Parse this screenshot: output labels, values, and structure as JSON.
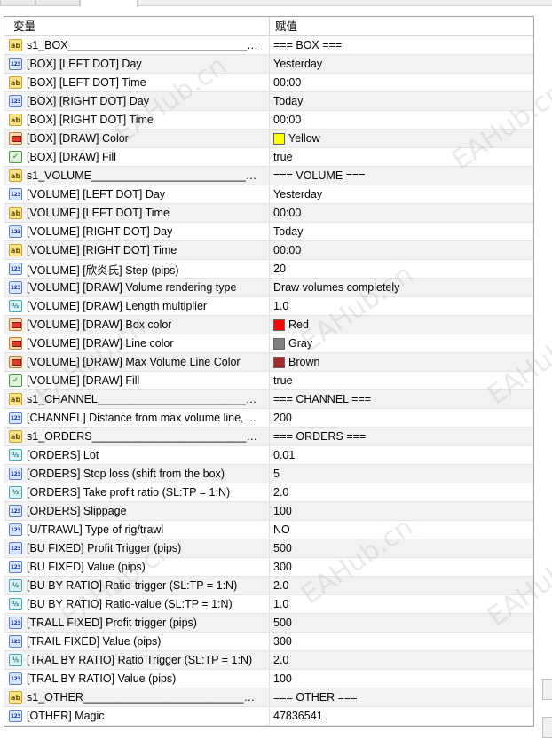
{
  "header": {
    "col_name": "变量",
    "col_value": "赋值"
  },
  "rows": [
    {
      "icon": "ab",
      "name": "s1_BOX________________________________________________",
      "value": "=== BOX ===",
      "sep": true
    },
    {
      "icon": "n123",
      "name": "[BOX] [LEFT DOT] Day",
      "value": "Yesterday"
    },
    {
      "icon": "ab",
      "name": "[BOX] [LEFT DOT] Time",
      "value": "00:00"
    },
    {
      "icon": "n123",
      "name": "[BOX] [RIGHT DOT] Day",
      "value": "Today"
    },
    {
      "icon": "ab",
      "name": "[BOX] [RIGHT DOT] Time",
      "value": "00:00"
    },
    {
      "icon": "color",
      "name": "[BOX] [DRAW] Color",
      "value": "Yellow",
      "swatch": "#ffff00"
    },
    {
      "icon": "bool",
      "name": "[BOX] [DRAW] Fill",
      "value": "true"
    },
    {
      "icon": "ab",
      "name": "s1_VOLUME______________________________________________",
      "value": "=== VOLUME ===",
      "sep": true
    },
    {
      "icon": "n123",
      "name": "[VOLUME] [LEFT DOT] Day",
      "value": "Yesterday"
    },
    {
      "icon": "ab",
      "name": "[VOLUME] [LEFT DOT] Time",
      "value": "00:00"
    },
    {
      "icon": "n123",
      "name": "[VOLUME] [RIGHT DOT] Day",
      "value": "Today"
    },
    {
      "icon": "ab",
      "name": "[VOLUME] [RIGHT DOT] Time",
      "value": "00:00"
    },
    {
      "icon": "n123",
      "name": "[VOLUME] [欣炎氐] Step (pips)",
      "value": "20"
    },
    {
      "icon": "n123",
      "name": "[VOLUME] [DRAW] Volume rendering type",
      "value": "Draw volumes completely"
    },
    {
      "icon": "ve",
      "name": "[VOLUME] [DRAW] Length multiplier",
      "value": "1.0"
    },
    {
      "icon": "color",
      "name": "[VOLUME] [DRAW] Box color",
      "value": "Red",
      "swatch": "#ff0000"
    },
    {
      "icon": "color",
      "name": "[VOLUME] [DRAW] Line color",
      "value": "Gray",
      "swatch": "#808080"
    },
    {
      "icon": "color",
      "name": "[VOLUME] [DRAW] Max Volume Line Color",
      "value": "Brown",
      "swatch": "#a52a2a"
    },
    {
      "icon": "bool",
      "name": "[VOLUME] [DRAW] Fill",
      "value": "true"
    },
    {
      "icon": "ab",
      "name": "s1_CHANNEL_____________________________________________",
      "value": "=== CHANNEL ===",
      "sep": true
    },
    {
      "icon": "n123",
      "name": "[CHANNEL] Distance from max volume line, ...",
      "value": "200"
    },
    {
      "icon": "ab",
      "name": "s1_ORDERS______________________________________________",
      "value": "=== ORDERS ===",
      "sep": true
    },
    {
      "icon": "ve",
      "name": "[ORDERS] Lot",
      "value": "0.01"
    },
    {
      "icon": "n123",
      "name": "[ORDERS] Stop loss (shift from the box)",
      "value": "5"
    },
    {
      "icon": "ve",
      "name": "[ORDERS] Take profit ratio (SL:TP = 1:N)",
      "value": "2.0"
    },
    {
      "icon": "n123",
      "name": "[ORDERS] Slippage",
      "value": "100"
    },
    {
      "icon": "n123",
      "name": "[U/TRAWL] Type of rig/trawl",
      "value": "NO"
    },
    {
      "icon": "n123",
      "name": "[BU FIXED] Profit Trigger (pips)",
      "value": "500"
    },
    {
      "icon": "n123",
      "name": "[BU FIXED] Value (pips)",
      "value": "300"
    },
    {
      "icon": "ve",
      "name": "[BU BY RATIO] Ratio-trigger (SL:TP = 1:N)",
      "value": "2.0"
    },
    {
      "icon": "ve",
      "name": "[BU BY RATIO] Ratio-value (SL:TP = 1:N)",
      "value": "1.0"
    },
    {
      "icon": "n123",
      "name": "[TRALL FIXED] Profit trigger (pips)",
      "value": "500"
    },
    {
      "icon": "n123",
      "name": "[TRAIL FIXED] Value (pips)",
      "value": "300"
    },
    {
      "icon": "ve",
      "name": "[TRAL BY RATIO] Ratio Trigger (SL:TP = 1:N)",
      "value": "2.0"
    },
    {
      "icon": "n123",
      "name": "[TRAL BY RATIO] Value (pips)",
      "value": "100"
    },
    {
      "icon": "ab",
      "name": "s1_OTHER_______________________________________________",
      "value": "=== OTHER ===",
      "sep": true
    },
    {
      "icon": "n123",
      "name": "[OTHER] Magic",
      "value": "47836541"
    }
  ],
  "icons": {
    "ab": {
      "name": "string-type-icon",
      "glyph": "ab"
    },
    "n123": {
      "name": "integer-type-icon",
      "glyph": "123"
    },
    "ve": {
      "name": "double-type-icon",
      "glyph": "½"
    },
    "color": {
      "name": "color-type-icon",
      "glyph": ""
    },
    "bool": {
      "name": "boolean-type-icon",
      "glyph": "✓"
    }
  },
  "watermark": "EAHub.cn"
}
